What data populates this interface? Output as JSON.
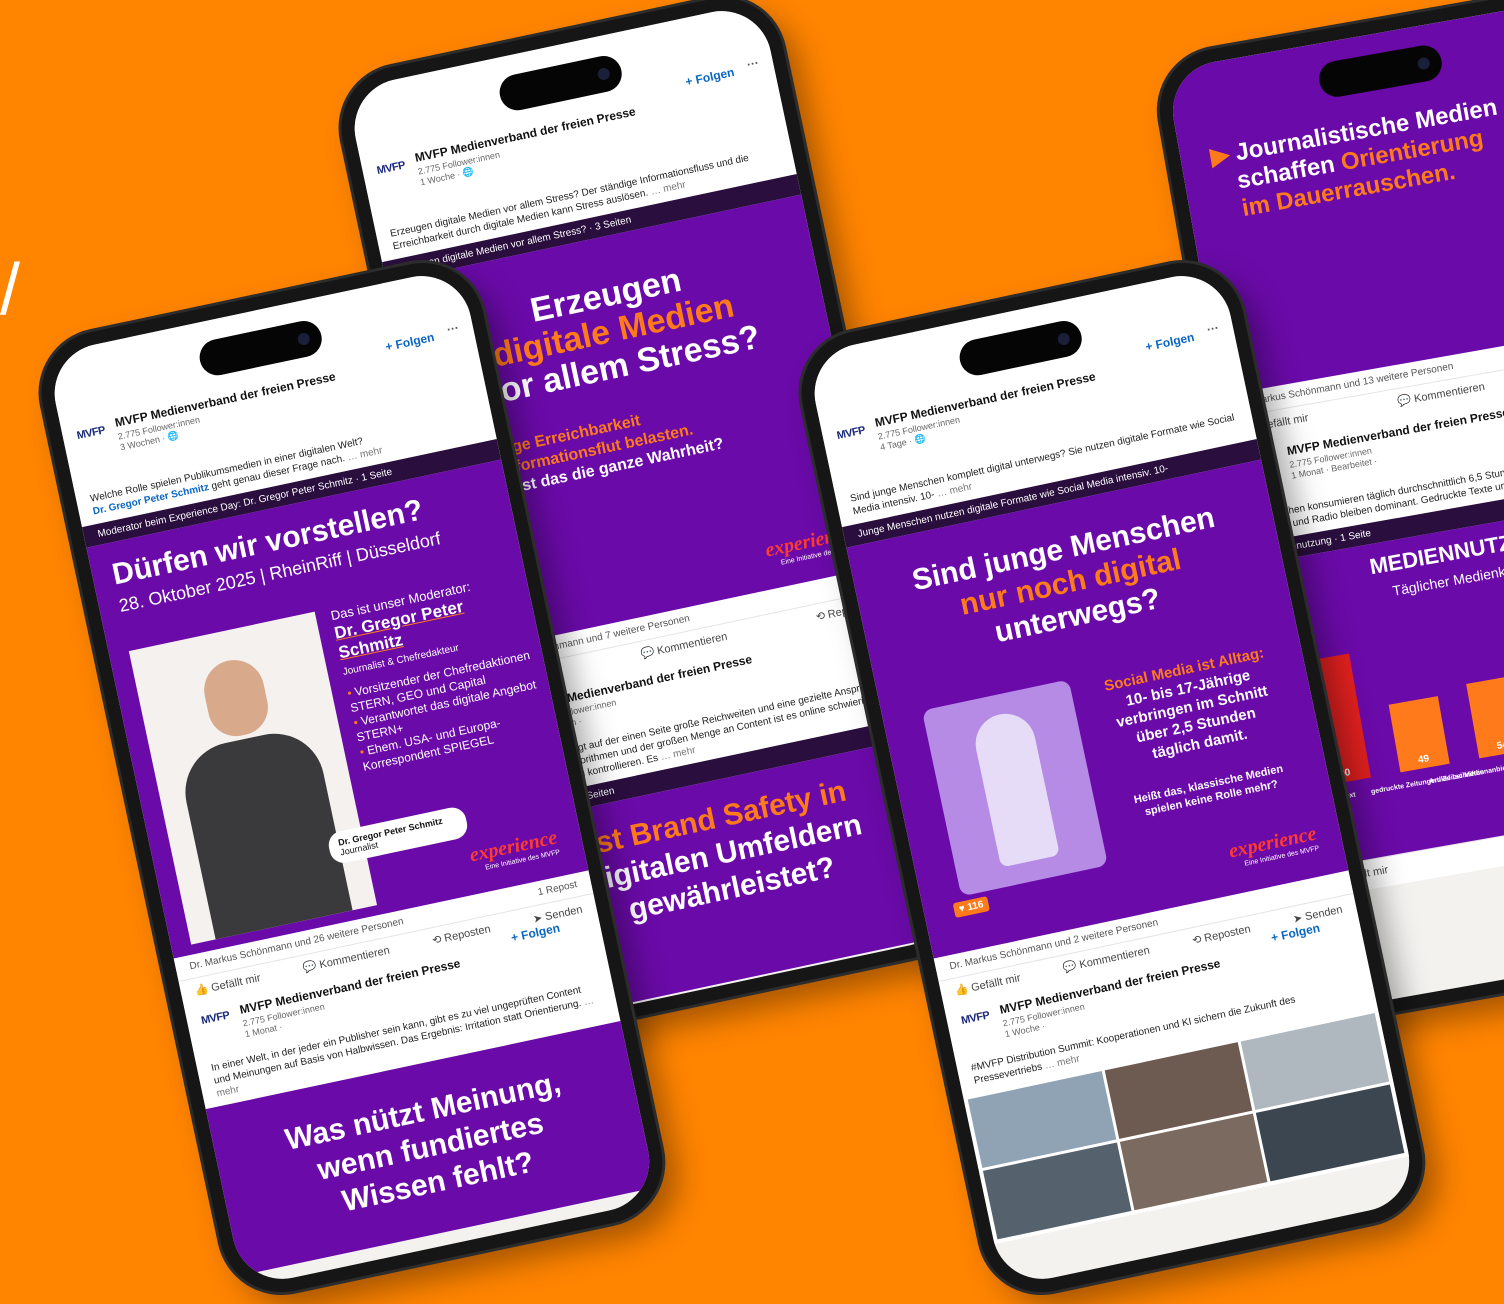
{
  "bg_color": "#ff8400",
  "accent_orange": "#ff7a1a",
  "slide_purple": "#6a0aa8",
  "linkedin_blue": "#0a66c2",
  "org_name": "MVFP Medienverband der freien Presse",
  "followers": "2.775 Follower:innen",
  "follow": "+ Folgen",
  "more": "… mehr",
  "like": "Gefällt mir",
  "comment": "Kommentieren",
  "repost": "Reposten",
  "send": "Senden",
  "logo": "MVFP",
  "brand": "experience",
  "brand_sub": "Eine Initiative des MVFP",
  "phone1": {
    "age": "3 Wochen · ",
    "caption": "Welche Rolle spielen Publikumsmedien in einer digitalen Welt?",
    "caption_link": "Dr. Gregor Peter Schmitz",
    "caption_rest": "geht genau dieser Frage nach.",
    "docbar": "Moderator beim Experience Day: Dr. Gregor Peter Schmitz · 1 Seite",
    "title": "Dürfen wir vorstellen?",
    "date": "28. Oktober 2025 | RheinRiff | Düsseldorf",
    "intro": "Das ist unser Moderator:",
    "name": "Dr. Gregor Peter Schmitz",
    "role": "Journalist & Chefredakteur",
    "bullets": [
      "Vorsitzender der Chefredaktionen STERN, GEO und Capital",
      "Verantwortet das digitale Angebot STERN+",
      "Ehem. USA- und Europa-Korrespondent SPIEGEL"
    ],
    "badge_name": "Dr. Gregor Peter Schmitz",
    "badge_role": "Journalist",
    "reactions": "Dr. Markus Schönmann und 26 weitere Personen",
    "reposts": "1 Repost",
    "post2_age": "1 Monat · ",
    "post2_caption": "In einer Welt, in der jeder ein Publisher sein kann, gibt es zu viel ungeprüften Content und Meinungen auf Basis von Halbwissen. Das Ergebnis: Irritation statt Orientierung.",
    "post2_title_a": "Was nützt Meinung,",
    "post2_title_b": "wenn fundiertes",
    "post2_title_c": "Wissen fehlt?"
  },
  "phone2": {
    "age": "1 Woche · ",
    "caption": "Erzeugen digitale Medien vor allem Stress? Der ständige Informationsfluss und die Erreichbarkeit durch digitale Medien kann Stress auslösen.",
    "docbar": "Erzeugen digitale Medien vor allem Stress? · 3 Seiten",
    "title_a": "Erzeugen",
    "title_b": "digitale Medien",
    "title_c": "vor allem Stress?",
    "sub_a": "Ständige Erreichbarkeit",
    "sub_b": "und Informationsflut belasten.",
    "sub_c": "Aber: Ist das die ganze Wahrheit?",
    "reactions": "Dr. Markus Schönmann und 7 weitere Personen",
    "post2_age": "2 Wochen · ",
    "post2_caption": "Social Media bringt auf der einen Seite große Reichweiten und eine gezielte Ansprache. Aufgrund von Algorithmen und der großen Menge an Content ist es online schwieriger, die Umgebung zu kontrollieren. Es",
    "post2_docbar": "Brand Safety · 3 Seiten",
    "post2_title_a": "Ist Brand Safety in",
    "post2_title_b": "digitalen Umfeldern",
    "post2_title_c": "gewährleistet?"
  },
  "phone3": {
    "age": "4 Tage · ",
    "caption": "Sind junge Menschen komplett digital unterwegs? Sie nutzen digitale Formate wie Social Media intensiv. 10-",
    "docbar": "Junge Menschen nutzen digitale Formate wie Social Media intensiv. 10-",
    "title_a": "Sind junge Menschen",
    "title_b": "nur noch digital",
    "title_c": "unterwegs?",
    "fact_head": "Social Media ist Alltag:",
    "fact_a": "10- bis 17-Jährige",
    "fact_b": "verbringen im Schnitt",
    "fact_c": "über 2,5 Stunden",
    "fact_d": "täglich damit.",
    "question_a": "Heißt das, klassische Medien",
    "question_b": "spielen keine Rolle mehr?",
    "tag": "116",
    "reactions": "Dr. Markus Schönmann und 2 weitere Personen",
    "post2_age": "1 Woche · ",
    "post2_caption": "#MVFP Distribution Summit: Kooperationen und KI sichern die Zukunft des Pressevertriebs"
  },
  "phone4": {
    "title_a": "Journalistische Medien",
    "title_b": "schaffen ",
    "title_c": "Orientierung",
    "title_d": "im Dauerrauschen.",
    "reactions": "Dr. Markus Schönmann und 13 weitere Personen",
    "post2_age": "1 Monat · Bearbeitet · ",
    "post2_caption": "Deutschen konsumieren täglich durchschnittlich 6,5 Stunden Medien. Klassische Kanäle wie TV und Radio bleiben dominant. Gedruckte Texte und Podcasts rasant wachsen.",
    "docbar": "Mediennutzung · 1 Seite",
    "chart_title": "MEDIENNUTZUNG",
    "chart_sub": "Täglicher Medienkonsum",
    "bars": [
      {
        "label": "Text",
        "value": 90
      },
      {
        "label": "gedruckte Zeitungen/ Zeitschriften",
        "value": 49
      },
      {
        "label": "Artikel bei Medienanbietern auf E-Mail-Portalen",
        "value": 54
      }
    ]
  }
}
